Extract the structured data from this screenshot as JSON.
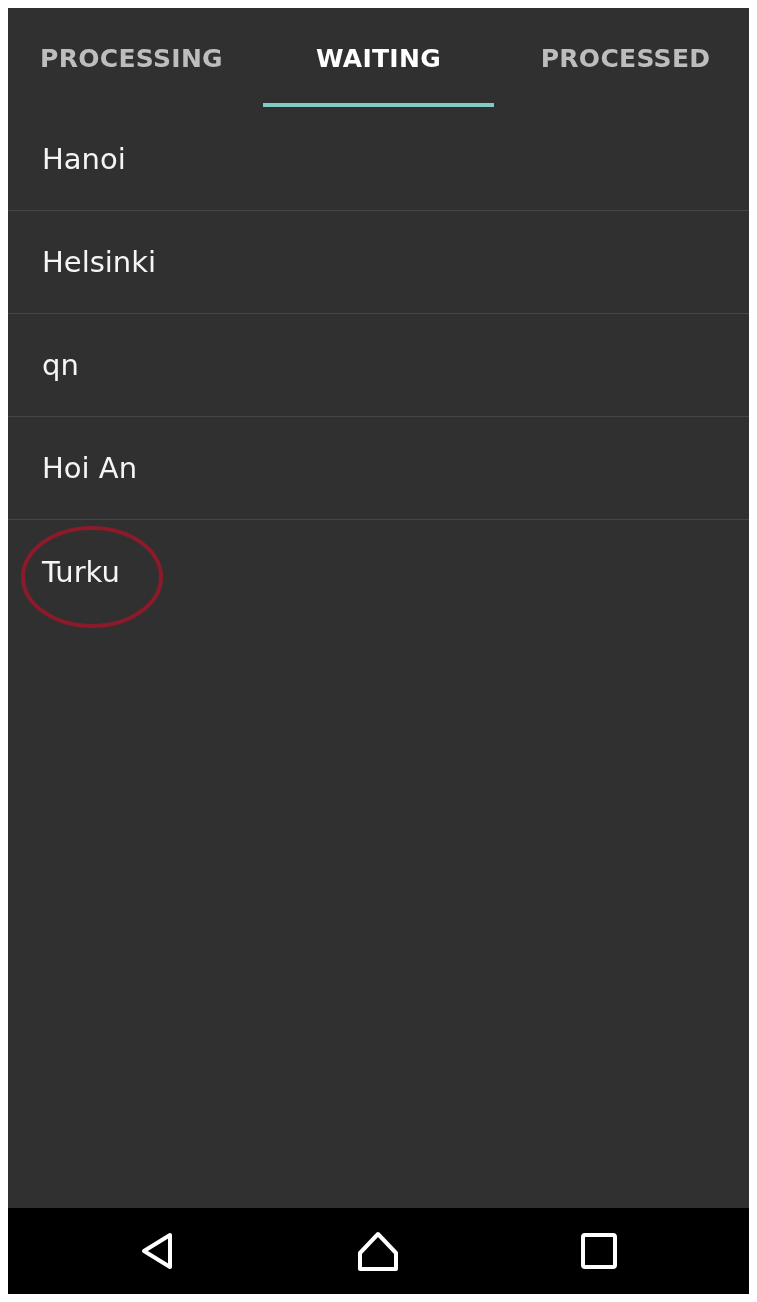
{
  "tabs": [
    {
      "label": "PROCESSING",
      "selected": false
    },
    {
      "label": "WAITING",
      "selected": true
    },
    {
      "label": "PROCESSED",
      "selected": false
    }
  ],
  "items": [
    {
      "label": "Hanoi",
      "circled": false
    },
    {
      "label": "Helsinki",
      "circled": false
    },
    {
      "label": "qn",
      "circled": false
    },
    {
      "label": "Hoi An",
      "circled": false
    },
    {
      "label": "Turku",
      "circled": true
    }
  ]
}
